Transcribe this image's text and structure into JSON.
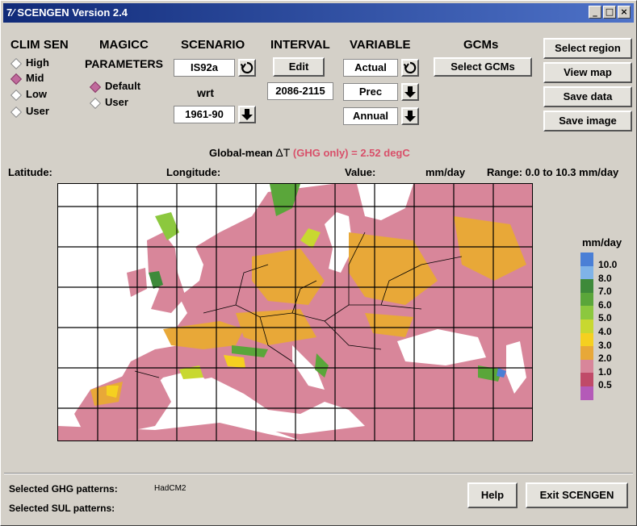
{
  "window": {
    "title": "SCENGEN Version 2.4",
    "minimize": "_",
    "maximize": "□",
    "close": "×"
  },
  "clim_sen": {
    "header": "CLIM SEN",
    "options": [
      "High",
      "Mid",
      "Low",
      "User"
    ],
    "selected": "Mid"
  },
  "magicc": {
    "header": "MAGICC",
    "subheader": "PARAMETERS",
    "options": [
      "Default",
      "User"
    ],
    "selected": "Default"
  },
  "scenario": {
    "header": "SCENARIO",
    "value": "IS92a",
    "wrt_label": "wrt",
    "baseline": "1961-90"
  },
  "interval": {
    "header": "INTERVAL",
    "edit_label": "Edit",
    "value": "2086-2115"
  },
  "variable": {
    "header": "VARIABLE",
    "type": "Actual",
    "variable": "Prec",
    "season": "Annual"
  },
  "gcms": {
    "header": "GCMs",
    "select_label": "Select GCMs"
  },
  "actions": {
    "select_region": "Select region",
    "view_map": "View map",
    "save_data": "Save data",
    "save_image": "Save image"
  },
  "global_mean": {
    "prefix": "Global-mean",
    "symbol": "ΔT",
    "ghg_note": "(GHG only)",
    "value": "= 2.52 degC"
  },
  "readout": {
    "latitude": "Latitude:",
    "longitude": "Longitude:",
    "value": "Value:",
    "units": "mm/day",
    "range": "Range: 0.0 to 10.3 mm/day"
  },
  "legend": {
    "title": "mm/day",
    "items": [
      {
        "label": "10.0",
        "color": "#4a7fd6"
      },
      {
        "label": "8.0",
        "color": "#7fb3e8"
      },
      {
        "label": "7.0",
        "color": "#3e8a3a"
      },
      {
        "label": "6.0",
        "color": "#5aa63a"
      },
      {
        "label": "5.0",
        "color": "#8cc83e"
      },
      {
        "label": "4.0",
        "color": "#c8d830"
      },
      {
        "label": "3.0",
        "color": "#f5d020"
      },
      {
        "label": "2.0",
        "color": "#e8a838"
      },
      {
        "label": "1.0",
        "color": "#d8869a"
      },
      {
        "label": "0.5",
        "color": "#c04a68"
      },
      {
        "label": "",
        "color": "#b45ab8"
      }
    ]
  },
  "footer": {
    "ghg_label": "Selected GHG patterns:",
    "ghg_value": "HadCM2",
    "sul_label": "Selected SUL patterns:",
    "help": "Help",
    "exit": "Exit SCENGEN"
  }
}
